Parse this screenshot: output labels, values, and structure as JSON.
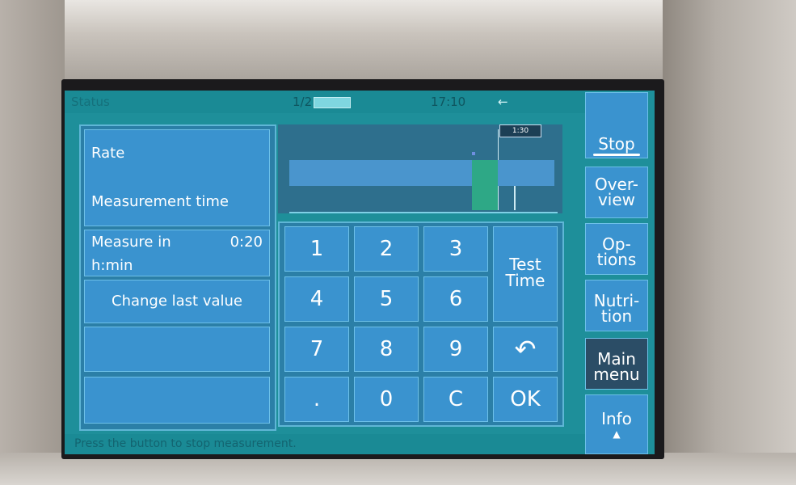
{
  "status": {
    "title": "Status",
    "page": "1/2",
    "time": "17:10",
    "arrow": "←"
  },
  "left_panel": {
    "rate_label": "Rate",
    "rate_ghost": "",
    "measurement_time_label": "Measurement time",
    "measure_in_label_line1": "Measure in",
    "measure_in_label_line2": "h:min",
    "measure_in_value": "0:20",
    "change_last_value_label": "Change last value"
  },
  "graph": {
    "tag": "1:30"
  },
  "keypad": {
    "k1": "1",
    "k2": "2",
    "k3": "3",
    "k4": "4",
    "k5": "5",
    "k6": "6",
    "k7": "7",
    "k8": "8",
    "k9": "9",
    "kdot": ".",
    "k0": "0",
    "kc": "C",
    "test_time_line1": "Test",
    "test_time_line2": "Time",
    "undo_symbol": "↶",
    "ok": "OK"
  },
  "side_buttons": {
    "stop": "Stop",
    "overview_line1": "Over-",
    "overview_line2": "view",
    "options_line1": "Op-",
    "options_line2": "tions",
    "nutrition_line1": "Nutri-",
    "nutrition_line2": "tion",
    "main_menu_line1": "Main",
    "main_menu_line2": "menu",
    "info": "Info",
    "info_icon": "▲"
  },
  "message": "Press the button to stop measurement."
}
